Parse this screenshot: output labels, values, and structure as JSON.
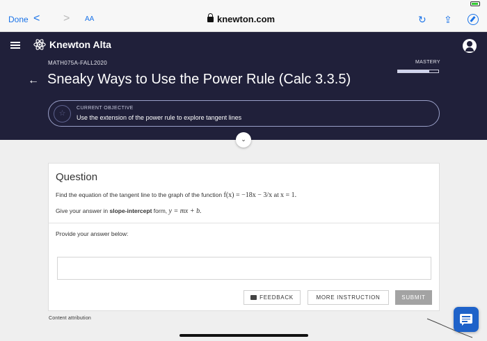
{
  "safari": {
    "done_label": "Done",
    "back_glyph": "<",
    "forward_glyph": ">",
    "text_size_label": "AA",
    "url": "knewton.com"
  },
  "header": {
    "brand": "Knewton Alta",
    "course": "MATH075A-FALL2020",
    "mastery_label": "MASTERY",
    "mastery_progress": 0.78,
    "back_glyph": "←",
    "title": "Sneaky Ways to Use the Power Rule (Calc 3.3.5)",
    "objective_label": "CURRENT OBJECTIVE",
    "objective_text": "Use the extension of the power rule to explore tangent lines"
  },
  "question": {
    "heading": "Question",
    "prompt_before": "Find the equation of the tangent line to the graph of the function ",
    "function_text": "f(x) = −18x − 3/x",
    "prompt_middle": " at ",
    "point_text": "x = 1.",
    "form_before": "Give your answer in ",
    "form_bold": "slope-intercept",
    "form_after": " form, ",
    "form_math": "y = mx + b.",
    "provide": "Provide your answer below:",
    "answer_value": ""
  },
  "buttons": {
    "feedback": "FEEDBACK",
    "more_instruction": "MORE INSTRUCTION",
    "submit": "SUBMIT"
  },
  "footer": {
    "attribution": "Content attribution"
  },
  "colors": {
    "header_bg": "#20203a",
    "link_blue": "#1a73e8",
    "chat_blue": "#1e62c9",
    "submit_disabled": "#a3a3a3"
  },
  "icons": [
    "lock-icon",
    "reload-icon",
    "share-icon",
    "compass-icon",
    "hamburger-icon",
    "atom-logo-icon",
    "account-icon",
    "star-icon",
    "chevron-down-icon",
    "feedback-icon",
    "chat-icon"
  ]
}
